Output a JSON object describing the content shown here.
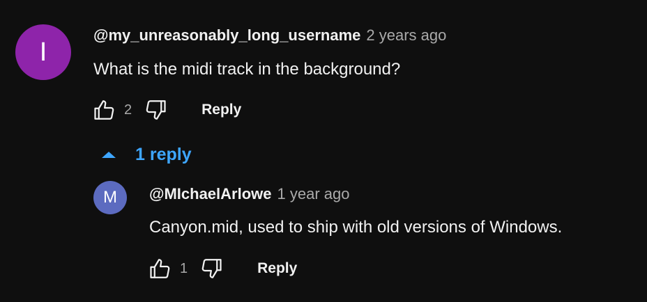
{
  "colors": {
    "background": "#0f0f0f",
    "text": "#f1f1f1",
    "secondary_text": "#aaaaaa",
    "link": "#3ea6ff"
  },
  "comment": {
    "avatar_letter": "I",
    "avatar_color": "#8e24aa",
    "username": "@my_unreasonably_long_username",
    "timestamp": "2 years ago",
    "text": "What is the midi track in the background?",
    "like_count": "2",
    "reply_label": "Reply",
    "icons": [
      "thumbs-up-icon",
      "thumbs-down-icon"
    ]
  },
  "replies_toggle": {
    "label": "1 reply",
    "icon": "caret-up-icon"
  },
  "reply": {
    "avatar_letter": "M",
    "avatar_color": "#5c6bc0",
    "username": "@MIchaelArlowe",
    "timestamp": "1 year ago",
    "text": "Canyon.mid, used to ship with old versions of Windows.",
    "like_count": "1",
    "reply_label": "Reply",
    "icons": [
      "thumbs-up-icon",
      "thumbs-down-icon"
    ]
  }
}
